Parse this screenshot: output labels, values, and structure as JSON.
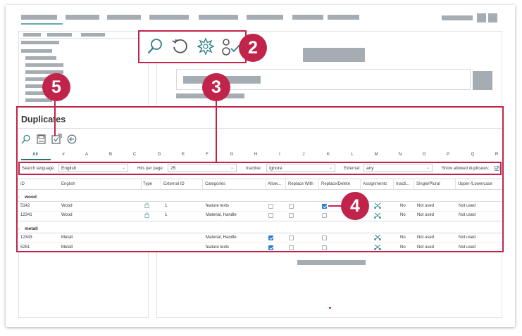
{
  "icons": {
    "search": "search-icon",
    "reset": "undo-icon",
    "highlight": "burst-icon",
    "assign": "person-check-icon",
    "save": "save-icon",
    "export": "export-icon",
    "back": "arrow-left-circle-icon",
    "lock": "lock-icon",
    "tools": "scissors-icon"
  },
  "colors": {
    "accent": "#c0244b",
    "teal": "#2b7f86",
    "checkbox": "#2a7fd4"
  },
  "badges": {
    "b2": "2",
    "b3": "3",
    "b4": "4",
    "b5": "5"
  },
  "duplicates": {
    "title": "Duplicates",
    "letters": [
      "All",
      "#",
      "A",
      "B",
      "C",
      "D",
      "E",
      "F",
      "G",
      "H",
      "I",
      "J",
      "K",
      "L",
      "M",
      "N",
      "O",
      "P",
      "Q",
      "R"
    ],
    "filters": {
      "search_language_label": "Search language:",
      "search_language_value": "English",
      "hits_label": "Hits per page:",
      "hits_value": "25",
      "inactive_label": "Inactive:",
      "inactive_value": "Ignore",
      "external_label": "External:",
      "external_value": "any",
      "show_allowed_label": "Show allowed duplicates:",
      "show_allowed_checked": true
    },
    "columns": [
      "ID",
      "English",
      "Type",
      "External ID",
      "Categories",
      "Allow...",
      "Replace With",
      "Replace/Delete",
      "Assignments",
      "Inacti...",
      "Single/Plural",
      "Upper-/Lowercase"
    ],
    "groups": [
      {
        "name": "wood",
        "rows": [
          {
            "id": "5142",
            "english": "Wood",
            "external_id": "1",
            "categories": "feature texts",
            "allow": false,
            "replace_with": false,
            "replace_delete": true,
            "inactive": "No",
            "single_plural": "Not used",
            "upper_lower": "Not used"
          },
          {
            "id": "12341",
            "english": "Wood",
            "external_id": "1",
            "categories": "Material, Handle",
            "allow": false,
            "replace_with": false,
            "replace_delete": false,
            "inactive": "No",
            "single_plural": "Not used",
            "upper_lower": "Not used"
          }
        ]
      },
      {
        "name": "metall",
        "rows": [
          {
            "id": "12343",
            "english": "Metall",
            "external_id": "",
            "categories": "Material, Handle",
            "allow": true,
            "replace_with": false,
            "replace_delete": false,
            "inactive": "No",
            "single_plural": "Not used",
            "upper_lower": "Not used"
          },
          {
            "id": "5251",
            "english": "Metall",
            "external_id": "",
            "categories": "feature texts",
            "allow": true,
            "replace_with": false,
            "replace_delete": false,
            "inactive": "No",
            "single_plural": "Not used",
            "upper_lower": "Not used"
          }
        ]
      }
    ]
  }
}
